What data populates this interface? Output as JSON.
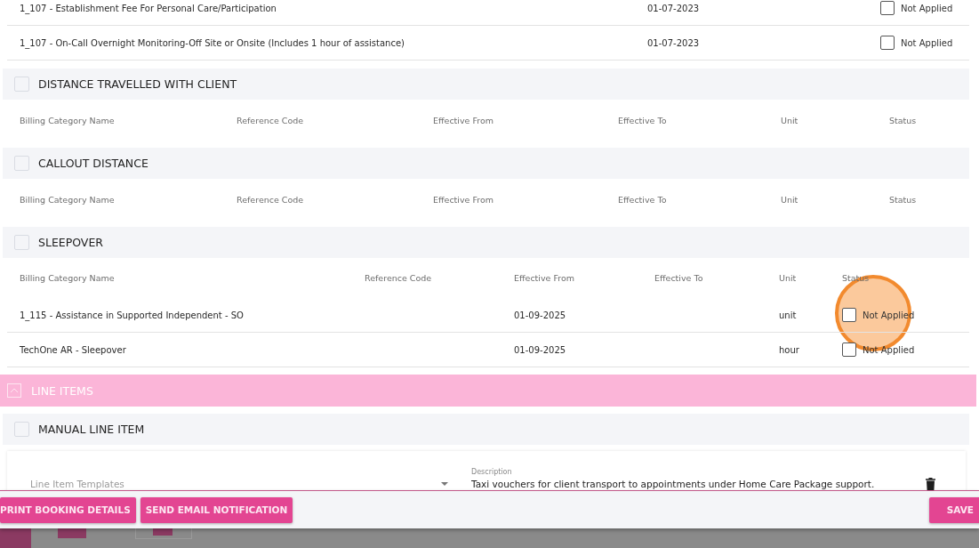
{
  "top_table": {
    "rows": [
      {
        "name": "1_107 - Establishment Fee For Personal Care/Participation",
        "effective_from": "01-07-2023",
        "status": {
          "label": "Not Applied",
          "checked": false
        }
      },
      {
        "name": "1_107 - On-Call Overnight Monitoring-Off Site or Onsite (Includes 1 hour of assistance)",
        "effective_from": "01-07-2023",
        "status": {
          "label": "Not Applied",
          "checked": false
        }
      }
    ]
  },
  "sections": [
    {
      "title": "DISTANCE TRAVELLED WITH CLIENT",
      "columns": [
        "Billing Category Name",
        "Reference Code",
        "Effective From",
        "Effective To",
        "Unit",
        "Status"
      ]
    },
    {
      "title": "CALLOUT DISTANCE",
      "columns": [
        "Billing Category Name",
        "Reference Code",
        "Effective From",
        "Effective To",
        "Unit",
        "Status"
      ]
    },
    {
      "title": "SLEEPOVER",
      "columns": [
        "Billing Category Name",
        "Reference Code",
        "Effective From",
        "Effective To",
        "Unit",
        "Status"
      ],
      "rows": [
        {
          "name": "1_115 - Assistance in Supported Independent - SO",
          "effective_from": "01-09-2025",
          "unit": "unit",
          "status": {
            "label": "Not Applied",
            "checked": false
          }
        },
        {
          "name": "TechOne AR - Sleepover",
          "effective_from": "01-09-2025",
          "unit": "hour",
          "status": {
            "label": "Not Applied",
            "checked": false
          }
        }
      ]
    }
  ],
  "line_items": {
    "title": "LINE ITEMS",
    "expanded": true
  },
  "manual_line_item": {
    "title": "MANUAL LINE ITEM",
    "template_field": {
      "placeholder": "Line Item Templates"
    },
    "description": {
      "label": "Description",
      "value": "Taxi vouchers for client transport to appointments under Home Care Package support."
    }
  },
  "footer_buttons": [
    {
      "label": "PRINT BOOKING DETAILS"
    },
    {
      "label": "SEND EMAIL NOTIFICATION"
    },
    {
      "label": "SAVE"
    }
  ]
}
